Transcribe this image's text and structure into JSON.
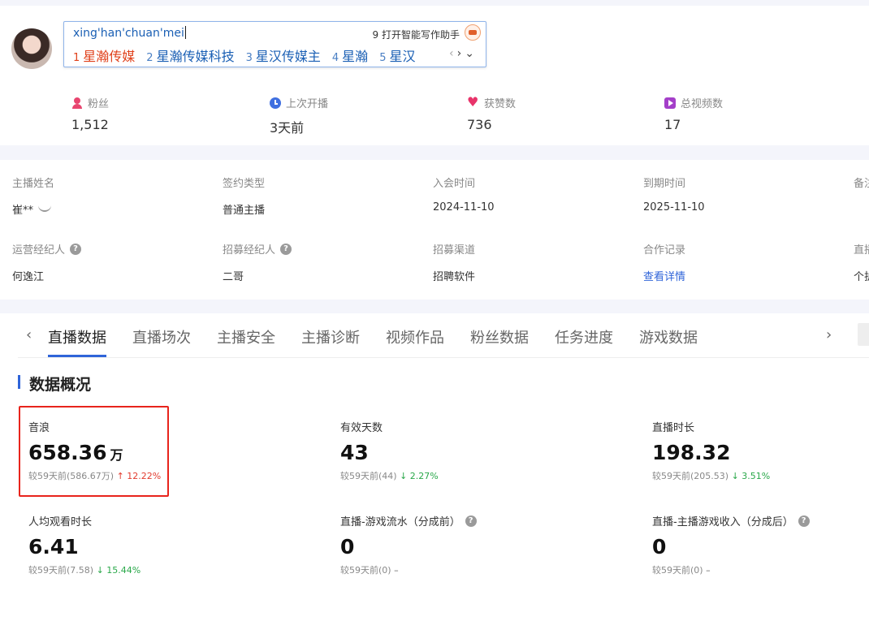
{
  "ime": {
    "input": "xing'han'chuan'mei",
    "assist_number": "9",
    "assist_label": "打开智能写作助手",
    "candidates": [
      {
        "num": "1",
        "text": "星瀚传媒"
      },
      {
        "num": "2",
        "text": "星瀚传媒科技"
      },
      {
        "num": "3",
        "text": "星汉传媒主"
      },
      {
        "num": "4",
        "text": "星瀚"
      },
      {
        "num": "5",
        "text": "星汉"
      }
    ],
    "nav_prev": "‹",
    "nav_next": "›",
    "nav_expand": "⌄"
  },
  "stats": [
    {
      "label": "粉丝",
      "value": "1,512",
      "icon": "fans-icon"
    },
    {
      "label": "上次开播",
      "value": "3天前",
      "icon": "clock-icon"
    },
    {
      "label": "获赞数",
      "value": "736",
      "icon": "heart-icon"
    },
    {
      "label": "总视频数",
      "value": "17",
      "icon": "video-icon"
    }
  ],
  "info": {
    "row1": [
      {
        "label": "主播姓名",
        "value": "崔**"
      },
      {
        "label": "签约类型",
        "value": "普通主播"
      },
      {
        "label": "入会时间",
        "value": "2024-11-10"
      },
      {
        "label": "到期时间",
        "value": "2025-11-10"
      },
      {
        "label": "备注",
        "value": ""
      }
    ],
    "row2": [
      {
        "label": "运营经纪人",
        "value": "何逸江"
      },
      {
        "label": "招募经纪人",
        "value": "二哥"
      },
      {
        "label": "招募渠道",
        "value": "招聘软件"
      },
      {
        "label": "合作记录",
        "value": "查看详情"
      },
      {
        "label": "直播",
        "value": "个护"
      }
    ]
  },
  "tabs": {
    "prev": "‹",
    "next": "›",
    "items": [
      "直播数据",
      "直播场次",
      "主播安全",
      "主播诊断",
      "视频作品",
      "粉丝数据",
      "任务进度",
      "游戏数据"
    ]
  },
  "section": {
    "title": "数据概况"
  },
  "metrics": [
    {
      "label": "音浪",
      "value": "658.36",
      "unit": "万",
      "compare": "较59天前(586.67万)",
      "trend_arrow": "↑",
      "trend": "12.22%",
      "direction": "up"
    },
    {
      "label": "有效天数",
      "value": "43",
      "unit": "",
      "compare": "较59天前(44)",
      "trend_arrow": "↓",
      "trend": "2.27%",
      "direction": "down"
    },
    {
      "label": "直播时长",
      "value": "198.32",
      "unit": "",
      "compare": "较59天前(205.53)",
      "trend_arrow": "↓",
      "trend": "3.51%",
      "direction": "down"
    },
    {
      "label": "人均观看时长",
      "value": "6.41",
      "unit": "",
      "compare": "较59天前(7.58)",
      "trend_arrow": "↓",
      "trend": "15.44%",
      "direction": "down"
    },
    {
      "label": "直播-游戏流水（分成前）",
      "value": "0",
      "unit": "",
      "compare": "较59天前(0)",
      "trend_arrow": "",
      "trend": "–",
      "direction": "neutral"
    },
    {
      "label": "直播-主播游戏收入（分成后）",
      "value": "0",
      "unit": "",
      "compare": "较59天前(0)",
      "trend_arrow": "",
      "trend": "–",
      "direction": "neutral"
    }
  ],
  "colors": {
    "accent": "#2f64d9",
    "up": "#e23b2e",
    "down": "#2aa84a",
    "highlight": "#e8241c"
  }
}
